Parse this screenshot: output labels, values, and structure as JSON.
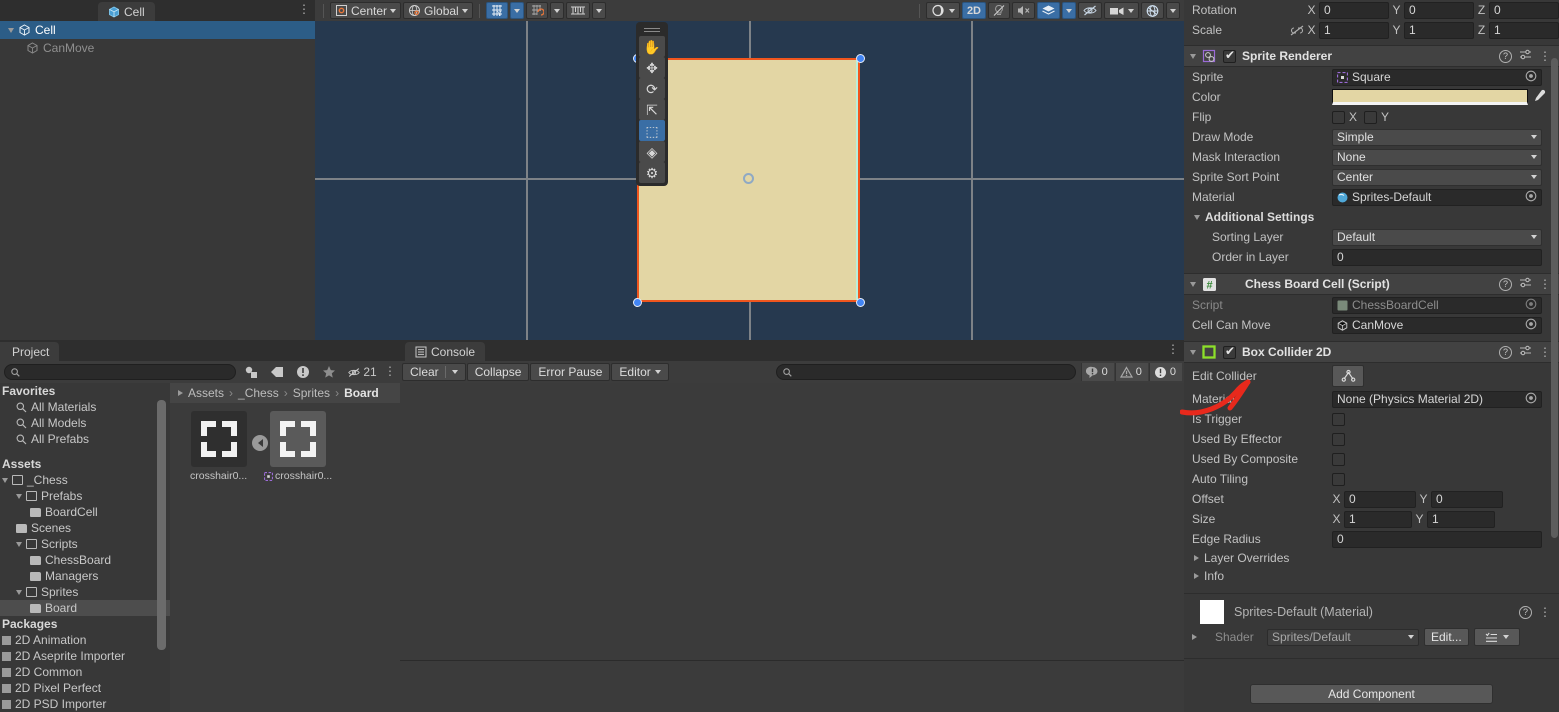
{
  "hierarchy": {
    "tab_label": "Cell",
    "items": [
      {
        "label": "Cell",
        "selected": true,
        "indent": 0
      },
      {
        "label": "CanMove",
        "selected": false,
        "indent": 1
      }
    ]
  },
  "scene": {
    "toolbar_left": [
      {
        "name": "pivot-mode",
        "label": "Center"
      },
      {
        "name": "handle-space",
        "label": "Global"
      }
    ],
    "toolbar_right": [
      {
        "name": "render-mode",
        "label": ""
      },
      {
        "name": "2d-toggle",
        "label": "2D"
      },
      {
        "name": "lighting-toggle",
        "label": ""
      },
      {
        "name": "audio-toggle",
        "label": ""
      },
      {
        "name": "fx-toggle",
        "label": ""
      },
      {
        "name": "hidden-objects",
        "label": ""
      },
      {
        "name": "camera-settings",
        "label": ""
      },
      {
        "name": "gizmos-toggle",
        "label": ""
      }
    ],
    "tools": [
      {
        "name": "hand-tool",
        "glyph": "✋",
        "active": false
      },
      {
        "name": "move-tool",
        "glyph": "✥",
        "active": false
      },
      {
        "name": "rotate-tool",
        "glyph": "⟳",
        "active": false
      },
      {
        "name": "scale-tool",
        "glyph": "⇱",
        "active": false
      },
      {
        "name": "rect-tool",
        "glyph": "⬚",
        "active": true
      },
      {
        "name": "transform-tool",
        "glyph": "◈",
        "active": false
      },
      {
        "name": "custom-tool",
        "glyph": "⚙",
        "active": false
      }
    ],
    "sprite_color": "#e3d6a4",
    "selection_color": "#f0561e",
    "background_color": "#26394f"
  },
  "project": {
    "tab_label": "Project",
    "search_placeholder": "",
    "filter_count": "21",
    "tree": [
      {
        "label": "Favorites",
        "type": "header",
        "indent": 0
      },
      {
        "label": "All Materials",
        "type": "search",
        "indent": 1
      },
      {
        "label": "All Models",
        "type": "search",
        "indent": 1
      },
      {
        "label": "All Prefabs",
        "type": "search",
        "indent": 1
      },
      {
        "label": "",
        "type": "gap",
        "indent": 0
      },
      {
        "label": "Assets",
        "type": "header",
        "indent": 0
      },
      {
        "label": "_Chess",
        "type": "folder-open",
        "indent": 0
      },
      {
        "label": "Prefabs",
        "type": "folder-open",
        "indent": 1
      },
      {
        "label": "BoardCell",
        "type": "folder",
        "indent": 2
      },
      {
        "label": "Scenes",
        "type": "folder",
        "indent": 1
      },
      {
        "label": "Scripts",
        "type": "folder-open",
        "indent": 1
      },
      {
        "label": "ChessBoard",
        "type": "folder",
        "indent": 2
      },
      {
        "label": "Managers",
        "type": "folder",
        "indent": 2
      },
      {
        "label": "Sprites",
        "type": "folder-open",
        "indent": 1
      },
      {
        "label": "Board",
        "type": "folder",
        "indent": 2,
        "selected": true
      },
      {
        "label": "Packages",
        "type": "header",
        "indent": 0
      },
      {
        "label": "2D Animation",
        "type": "package",
        "indent": 0
      },
      {
        "label": "2D Aseprite Importer",
        "type": "package",
        "indent": 0
      },
      {
        "label": "2D Common",
        "type": "package",
        "indent": 0
      },
      {
        "label": "2D Pixel Perfect",
        "type": "package",
        "indent": 0
      },
      {
        "label": "2D PSD Importer",
        "type": "package",
        "indent": 0
      }
    ],
    "breadcrumb": [
      "Assets",
      "_Chess",
      "Sprites",
      "Board"
    ],
    "assets": [
      {
        "label": "crosshair0...",
        "selected": false
      },
      {
        "label": "crosshair0...",
        "selected": true
      }
    ]
  },
  "console": {
    "tab_label": "Console",
    "buttons": [
      {
        "name": "clear-button",
        "label": "Clear"
      },
      {
        "name": "collapse-button",
        "label": "Collapse"
      },
      {
        "name": "error-pause-button",
        "label": "Error Pause"
      },
      {
        "name": "editor-dropdown",
        "label": "Editor"
      }
    ],
    "search_placeholder": "",
    "counters": [
      {
        "name": "log-count",
        "value": "0"
      },
      {
        "name": "warning-count",
        "value": "0"
      },
      {
        "name": "error-count",
        "value": "0"
      }
    ]
  },
  "inspector": {
    "transform": {
      "rotation": {
        "label": "Rotation",
        "x": "0",
        "y": "0",
        "z": "0"
      },
      "scale": {
        "label": "Scale",
        "x": "1",
        "y": "1",
        "z": "1"
      }
    },
    "sprite_renderer": {
      "title": "Sprite Renderer",
      "enabled": true,
      "sprite": {
        "label": "Sprite",
        "value": "Square"
      },
      "color": {
        "label": "Color",
        "value": "#e3d6a4"
      },
      "flip": {
        "label": "Flip",
        "x_label": "X",
        "y_label": "Y",
        "x": false,
        "y": false
      },
      "draw_mode": {
        "label": "Draw Mode",
        "value": "Simple"
      },
      "mask_interaction": {
        "label": "Mask Interaction",
        "value": "None"
      },
      "sprite_sort_point": {
        "label": "Sprite Sort Point",
        "value": "Center"
      },
      "material": {
        "label": "Material",
        "value": "Sprites-Default"
      },
      "additional_settings": {
        "title": "Additional Settings",
        "sorting_layer": {
          "label": "Sorting Layer",
          "value": "Default"
        },
        "order_in_layer": {
          "label": "Order in Layer",
          "value": "0"
        }
      }
    },
    "chess_board_cell": {
      "title": "Chess Board Cell (Script)",
      "script": {
        "label": "Script",
        "value": "ChessBoardCell"
      },
      "cell_can_move": {
        "label": "Cell Can Move",
        "value": "CanMove"
      }
    },
    "box_collider_2d": {
      "title": "Box Collider 2D",
      "enabled": true,
      "edit_collider": {
        "label": "Edit Collider"
      },
      "material": {
        "label": "Material",
        "value": "None (Physics Material 2D)"
      },
      "is_trigger": {
        "label": "Is Trigger",
        "value": false
      },
      "used_by_effector": {
        "label": "Used By Effector",
        "value": false
      },
      "used_by_composite": {
        "label": "Used By Composite",
        "value": false
      },
      "auto_tiling": {
        "label": "Auto Tiling",
        "value": false
      },
      "offset": {
        "label": "Offset",
        "x": "0",
        "y": "0"
      },
      "size": {
        "label": "Size",
        "x": "1",
        "y": "1"
      },
      "edge_radius": {
        "label": "Edge Radius",
        "value": "0"
      },
      "layer_overrides": {
        "label": "Layer Overrides"
      },
      "info": {
        "label": "Info"
      }
    },
    "material_preview": {
      "title": "Sprites-Default (Material)",
      "shader": {
        "label": "Shader",
        "value": "Sprites/Default"
      },
      "edit_button": "Edit..."
    },
    "add_component": "Add Component"
  },
  "annotation": {
    "color": "#e8291c",
    "name": "red-arrow-annotation"
  }
}
